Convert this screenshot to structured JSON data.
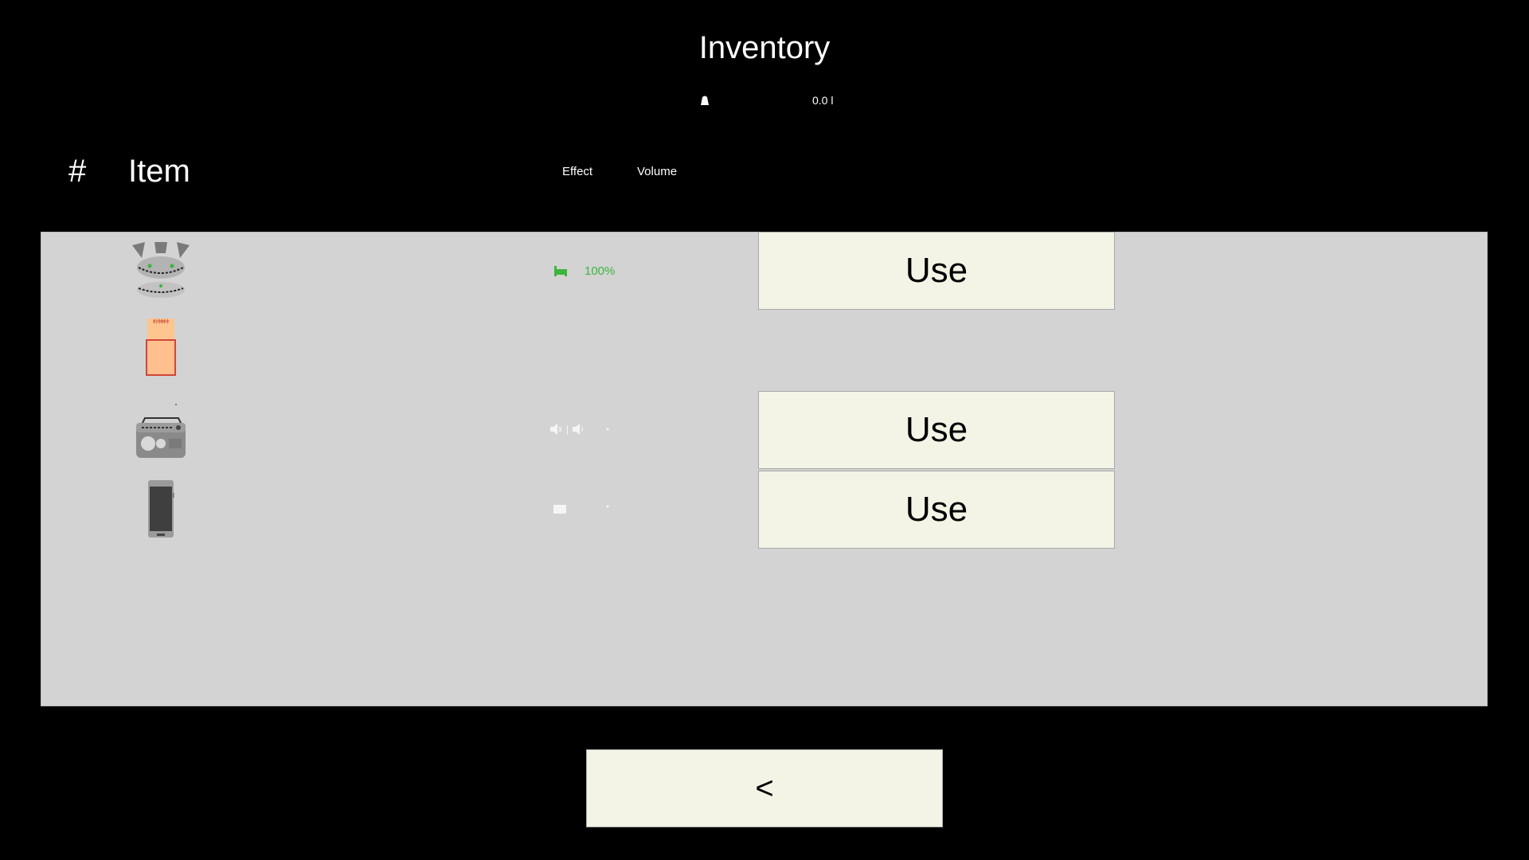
{
  "header": {
    "title": "Inventory",
    "capacity_value": "0.0 l",
    "capacity_icon": "weight-icon"
  },
  "columns": {
    "number": "#",
    "item": "Item",
    "effect": "Effect",
    "volume": "Volume"
  },
  "items": [
    {
      "icon": "helmet-icon",
      "effect_icon": "bed-icon",
      "effect_value": "100%",
      "use_label": "Use"
    },
    {
      "icon": "medicine-box-icon",
      "box_label": "ϕÿϕϕϕϕ"
    },
    {
      "icon": "radio-icon",
      "effect_icon": "speaker-icon",
      "use_label": "Use"
    },
    {
      "icon": "phone-icon",
      "effect_icon": "message-icon",
      "use_label": "Use"
    }
  ],
  "footer": {
    "back_label": "<"
  },
  "colors": {
    "background": "#000000",
    "panel": "#d3d3d3",
    "button": "#f3f4e6",
    "effect_green": "#3cb53c"
  }
}
